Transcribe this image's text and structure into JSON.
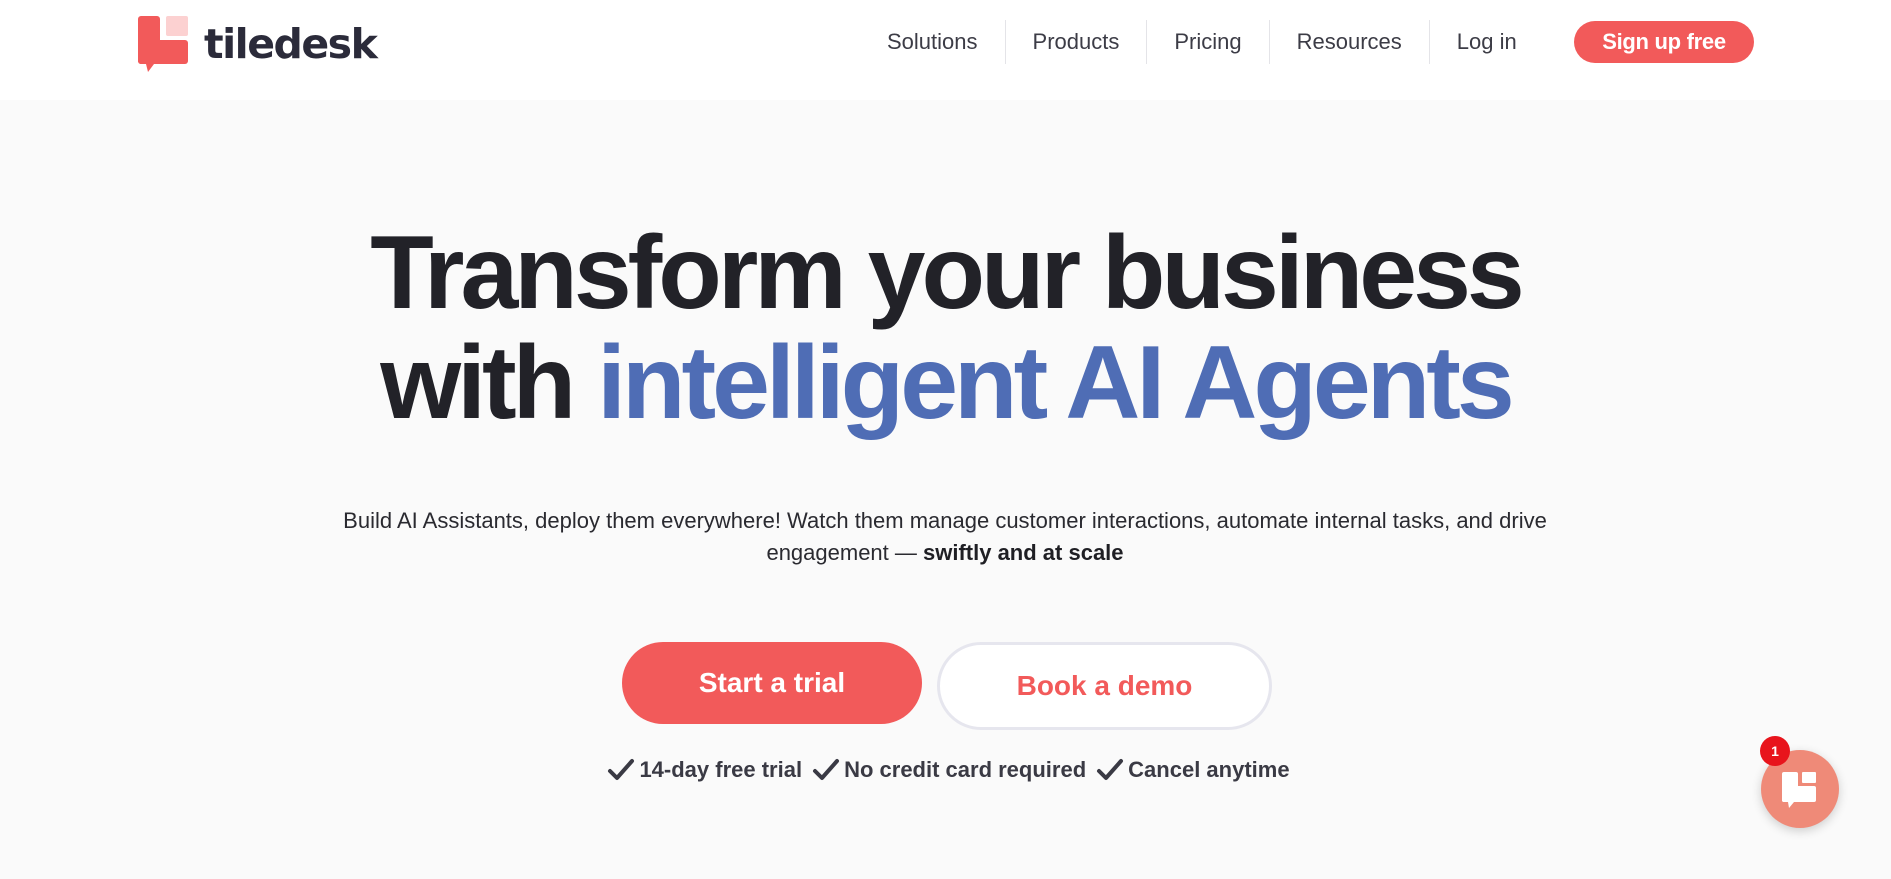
{
  "brand": {
    "name": "tiledesk",
    "primary_color": "#f25a5a",
    "accent_color": "#4f6db5"
  },
  "nav": {
    "items": [
      "Solutions",
      "Products",
      "Pricing",
      "Resources"
    ],
    "login": "Log in",
    "signup": "Sign up free"
  },
  "hero": {
    "title_line1": "Transform your business",
    "title_line2_prefix": "with ",
    "title_line2_accent": "intelligent AI Agents",
    "subtitle_text": "Build AI Assistants, deploy them everywhere! Watch them manage customer interactions, automate internal tasks, and drive engagement — ",
    "subtitle_bold": "swiftly and at scale",
    "primary_cta": "Start a trial",
    "secondary_cta": "Book a demo",
    "perks": [
      "14-day free trial",
      "No credit card required",
      "Cancel anytime"
    ]
  },
  "chat_widget": {
    "badge_count": "1",
    "icon": "chat-logo-icon"
  }
}
